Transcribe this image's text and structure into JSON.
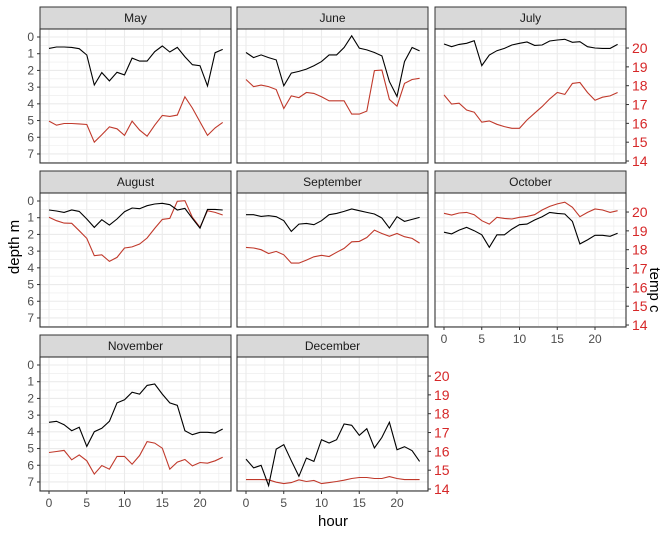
{
  "chart_data": {
    "type": "line",
    "title": "",
    "xlabel": "hour",
    "ylabel": "depth m",
    "y2label": "temp c",
    "xlim": [
      0,
      23
    ],
    "ylim": [
      7.5,
      -0.5
    ],
    "y2lim": [
      14,
      20
    ],
    "x_ticks": [
      "0",
      "5",
      "10",
      "15",
      "20"
    ],
    "x_tick_values": [
      0,
      5,
      10,
      15,
      20
    ],
    "y_ticks": [
      "0",
      "1",
      "2",
      "3",
      "4",
      "5",
      "6",
      "7"
    ],
    "y2_ticks": [
      "14",
      "15",
      "16",
      "17",
      "18",
      "19",
      "20"
    ],
    "grid": true,
    "legend": "none",
    "colors": {
      "depth": "#000000",
      "temp": "#c0392b",
      "temp_axis": "#d62728",
      "strip_bg": "#d9d9d9",
      "grid": "#ebebeb"
    },
    "series_names": [
      "depth",
      "temp"
    ],
    "x": [
      0,
      1,
      2,
      3,
      4,
      5,
      6,
      7,
      8,
      9,
      10,
      11,
      12,
      13,
      14,
      15,
      16,
      17,
      18,
      19,
      20,
      21,
      22,
      23
    ],
    "panels": [
      {
        "month": "May",
        "depth": [
          0.68,
          0.6,
          0.6,
          0.62,
          0.7,
          1.08,
          2.87,
          2.13,
          2.63,
          2.11,
          2.27,
          1.26,
          1.44,
          1.44,
          0.88,
          0.54,
          0.9,
          0.62,
          1.18,
          1.66,
          1.72,
          2.93,
          0.94,
          0.74
        ],
        "temp": [
          16.12,
          15.9,
          15.99,
          15.99,
          15.97,
          15.94,
          15.0,
          15.39,
          15.81,
          15.71,
          15.36,
          16.12,
          15.64,
          15.32,
          15.9,
          16.42,
          16.37,
          16.44,
          17.41,
          16.81,
          16.08,
          15.36,
          15.76,
          16.05
        ]
      },
      {
        "month": "June",
        "depth": [
          0.93,
          1.23,
          1.07,
          1.23,
          1.37,
          2.92,
          2.16,
          2.06,
          1.92,
          1.72,
          1.47,
          1.07,
          1.07,
          0.63,
          -0.07,
          0.67,
          0.77,
          0.93,
          1.13,
          2.67,
          3.56,
          1.47,
          0.63,
          0.83
        ],
        "temp": [
          18.33,
          17.95,
          18.03,
          17.95,
          17.8,
          16.79,
          17.46,
          17.37,
          17.64,
          17.59,
          17.41,
          17.2,
          17.2,
          17.2,
          16.49,
          16.49,
          16.65,
          18.8,
          18.83,
          17.27,
          16.91,
          18.12,
          18.33,
          18.39
        ]
      },
      {
        "month": "July",
        "depth": [
          0.42,
          0.58,
          0.44,
          0.38,
          0.22,
          1.71,
          1.08,
          0.82,
          0.68,
          0.48,
          0.38,
          0.3,
          0.5,
          0.48,
          0.24,
          0.18,
          0.14,
          0.32,
          0.28,
          0.58,
          0.66,
          0.68,
          0.68,
          0.44
        ],
        "temp": [
          17.51,
          17.02,
          17.07,
          16.71,
          16.59,
          16.06,
          16.13,
          15.95,
          15.83,
          15.74,
          15.74,
          16.18,
          16.54,
          16.89,
          17.3,
          17.64,
          17.54,
          18.12,
          18.17,
          17.64,
          17.23,
          17.39,
          17.46,
          17.64
        ]
      },
      {
        "month": "August",
        "depth": [
          0.54,
          0.6,
          0.68,
          0.54,
          0.62,
          1.08,
          1.58,
          1.12,
          1.44,
          1.08,
          0.64,
          0.42,
          0.46,
          0.28,
          0.18,
          0.14,
          0.22,
          0.54,
          0.44,
          1.04,
          1.62,
          0.5,
          0.5,
          0.54
        ],
        "temp": [
          19.72,
          19.54,
          19.41,
          19.4,
          19.01,
          18.6,
          17.68,
          17.73,
          17.38,
          17.59,
          18.09,
          18.15,
          18.3,
          18.62,
          19.13,
          19.61,
          19.66,
          20.57,
          20.6,
          19.72,
          19.19,
          20.07,
          19.98,
          19.84
        ]
      },
      {
        "month": "September",
        "depth": [
          0.82,
          0.82,
          0.92,
          0.88,
          0.94,
          1.18,
          1.82,
          1.38,
          1.34,
          1.42,
          1.18,
          0.82,
          0.74,
          0.62,
          0.48,
          0.58,
          0.68,
          0.78,
          1.02,
          1.62,
          0.94,
          1.22,
          1.1,
          0.98
        ],
        "temp": [
          18.12,
          18.09,
          18.0,
          17.8,
          17.91,
          17.73,
          17.29,
          17.29,
          17.45,
          17.62,
          17.7,
          17.64,
          17.86,
          18.07,
          18.42,
          18.44,
          18.65,
          19.04,
          18.86,
          18.71,
          18.86,
          18.69,
          18.6,
          18.35
        ]
      },
      {
        "month": "October",
        "depth": [
          1.87,
          1.97,
          1.74,
          1.58,
          1.78,
          2.02,
          2.77,
          2.02,
          2.02,
          1.68,
          1.42,
          1.38,
          1.14,
          0.94,
          0.68,
          0.74,
          0.78,
          1.22,
          2.57,
          2.33,
          2.05,
          2.05,
          2.11,
          1.93
        ],
        "temp": [
          19.93,
          19.84,
          19.95,
          19.98,
          19.86,
          19.54,
          19.36,
          19.72,
          19.66,
          19.63,
          19.72,
          19.77,
          19.86,
          20.11,
          20.3,
          20.43,
          20.52,
          20.25,
          19.75,
          19.98,
          20.16,
          20.11,
          19.98,
          20.07
        ]
      },
      {
        "month": "November",
        "depth": [
          3.43,
          3.37,
          3.57,
          3.93,
          3.73,
          4.87,
          3.99,
          3.79,
          3.37,
          2.27,
          2.08,
          1.63,
          1.74,
          1.22,
          1.14,
          1.74,
          2.27,
          2.41,
          3.93,
          4.17,
          4.03,
          4.03,
          4.07,
          3.83
        ],
        "temp": [
          15.94,
          15.99,
          16.05,
          15.55,
          15.81,
          15.5,
          14.79,
          15.25,
          15.05,
          15.73,
          15.73,
          15.32,
          15.78,
          16.52,
          16.44,
          16.17,
          15.05,
          15.43,
          15.57,
          15.23,
          15.41,
          15.37,
          15.5,
          15.69
        ]
      },
      {
        "month": "December",
        "depth": [
          5.63,
          6.16,
          6.0,
          7.22,
          5.03,
          4.77,
          5.73,
          6.66,
          5.57,
          5.77,
          4.47,
          4.67,
          4.47,
          3.53,
          3.61,
          4.21,
          3.81,
          4.97,
          4.33,
          3.43,
          5.07,
          4.89,
          5.13,
          5.77
        ],
        "temp": [
          14.5,
          14.5,
          14.5,
          14.49,
          14.36,
          14.29,
          14.34,
          14.49,
          14.4,
          14.45,
          14.29,
          14.34,
          14.4,
          14.47,
          14.56,
          14.61,
          14.61,
          14.56,
          14.56,
          14.66,
          14.56,
          14.5,
          14.5,
          14.5
        ]
      }
    ]
  }
}
